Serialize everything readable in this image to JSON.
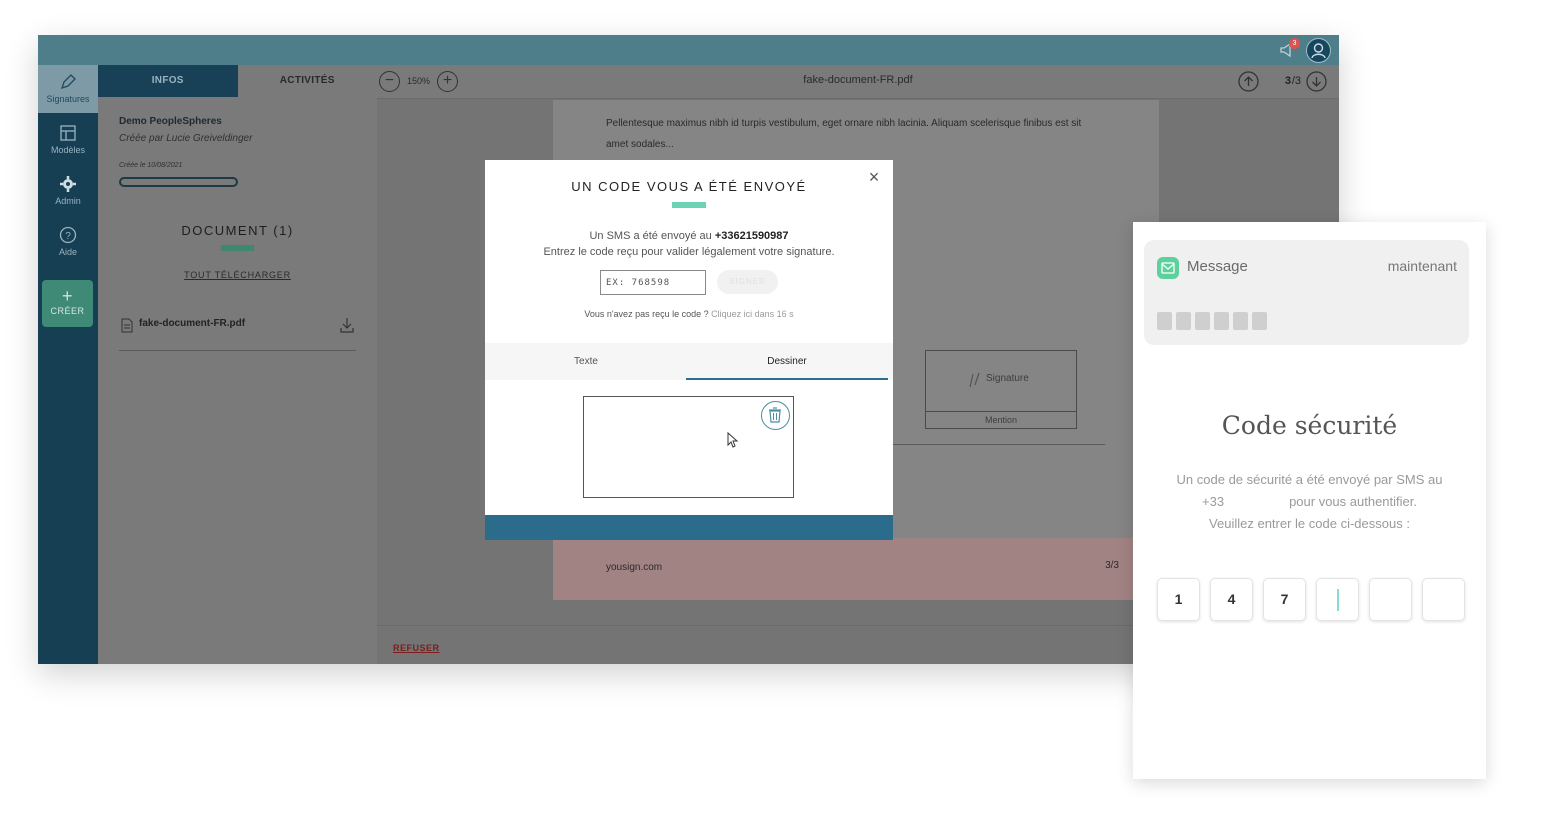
{
  "app": {
    "notifications_count": "3",
    "rail": [
      {
        "label": "Signatures",
        "icon": "pen-icon"
      },
      {
        "label": "Modèles",
        "icon": "template-icon"
      },
      {
        "label": "Admin",
        "icon": "gear-icon"
      },
      {
        "label": "Aide",
        "icon": "help-icon"
      }
    ],
    "create_label": "CRÉER"
  },
  "left_panel": {
    "tabs": [
      "INFOS",
      "ACTIVITÉS"
    ],
    "procedure_title": "Demo PeopleSpheres",
    "created_by": "Créée par Lucie Greiveldinger",
    "created_on": "Créée le 10/08/2021",
    "document_heading": "DOCUMENT (1)",
    "download_all": "TOUT TÉLÉCHARGER",
    "file_name": "fake-document-FR.pdf"
  },
  "viewer": {
    "zoom": "150%",
    "document_name": "fake-document-FR.pdf",
    "current_page": "3",
    "total_pages": "/3",
    "body_text": "Pellentesque maximus nibh id turpis vestibulum, eget ornare nibh lacinia. Aliquam scelerisque finibus est sit amet sodales...",
    "signature_label": "Signature",
    "mention_label": "Mention",
    "footer_domain": "yousign.com",
    "footer_page": "3/3",
    "refuse_label": "REFUSER"
  },
  "modal": {
    "title": "UN CODE VOUS A ÉTÉ ENVOYÉ",
    "sms_prefix": "Un SMS a été envoyé au ",
    "phone_number": "+33621590987",
    "instruction": "Entrez le code reçu pour valider légalement votre signature.",
    "code_placeholder": "EX: 768598",
    "sign_label": "SIGNER",
    "resend_prefix": "Vous n'avez pas reçu le code ? ",
    "resend_link": "Cliquez ici dans 16 s",
    "tabs": [
      "Texte",
      "Dessiner"
    ]
  },
  "phone": {
    "message_app": "Message",
    "message_time": "maintenant",
    "title": "Code sécurité",
    "line1": "Un code de sécurité a été envoyé par SMS au",
    "line2": "+33                  pour vous authentifier.",
    "line3": "Veuillez entrer le code ci-dessous :",
    "code_digits": [
      "1",
      "4",
      "7",
      "",
      "",
      ""
    ]
  },
  "colors": {
    "accent_green": "#6dd3b4",
    "brand_blue": "#2b6c8c",
    "rail_dark": "#163f54"
  }
}
